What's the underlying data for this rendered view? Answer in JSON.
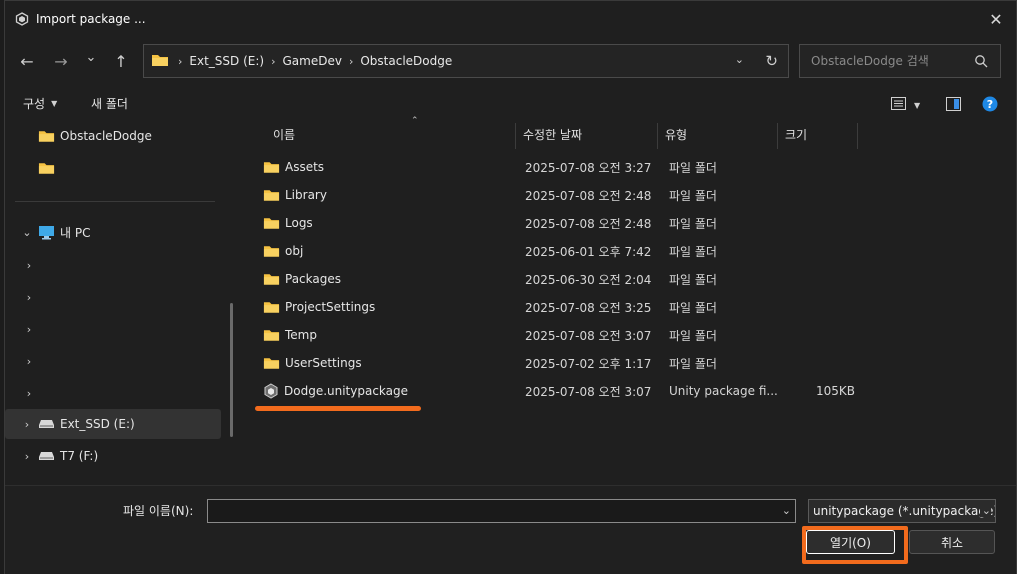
{
  "window": {
    "title": "Import package ...",
    "close_glyph": "✕"
  },
  "nav": {
    "back_glyph": "←",
    "forward_glyph": "→",
    "recent_glyph": "⌄",
    "up_glyph": "↑",
    "breadcrumb": [
      "Ext_SSD (E:)",
      "GameDev",
      "ObstacleDodge"
    ],
    "breadcrumb_sep": "›",
    "search_placeholder": "ObstacleDodge 검색"
  },
  "commandbar": {
    "organize": "구성",
    "new_folder": "새 폴더"
  },
  "sidebar": {
    "items": [
      {
        "label": "ObstacleDodge",
        "icon": "folder-icon"
      },
      {
        "label": "",
        "icon": "folder-icon"
      },
      {
        "label": "내 PC",
        "icon": "pc-icon"
      },
      {
        "label": ""
      },
      {
        "label": ""
      },
      {
        "label": ""
      },
      {
        "label": ""
      },
      {
        "label": ""
      },
      {
        "label": "Ext_SSD (E:)",
        "icon": "drive-icon"
      },
      {
        "label": "T7 (F:)",
        "icon": "drive-icon"
      }
    ]
  },
  "columns": {
    "name": "이름",
    "date": "수정한 날짜",
    "type": "유형",
    "size": "크기"
  },
  "files": [
    {
      "name": "Assets",
      "date": "2025-07-08 오전 3:27",
      "type": "파일 폴더",
      "size": "",
      "icon": "folder-icon"
    },
    {
      "name": "Library",
      "date": "2025-07-08 오전 2:48",
      "type": "파일 폴더",
      "size": "",
      "icon": "folder-icon"
    },
    {
      "name": "Logs",
      "date": "2025-07-08 오전 2:48",
      "type": "파일 폴더",
      "size": "",
      "icon": "folder-icon"
    },
    {
      "name": "obj",
      "date": "2025-06-01 오후 7:42",
      "type": "파일 폴더",
      "size": "",
      "icon": "folder-icon"
    },
    {
      "name": "Packages",
      "date": "2025-06-30 오전 2:04",
      "type": "파일 폴더",
      "size": "",
      "icon": "folder-icon"
    },
    {
      "name": "ProjectSettings",
      "date": "2025-07-08 오전 3:25",
      "type": "파일 폴더",
      "size": "",
      "icon": "folder-icon"
    },
    {
      "name": "Temp",
      "date": "2025-07-08 오전 3:07",
      "type": "파일 폴더",
      "size": "",
      "icon": "folder-icon"
    },
    {
      "name": "UserSettings",
      "date": "2025-07-02 오후 1:17",
      "type": "파일 폴더",
      "size": "",
      "icon": "folder-icon"
    },
    {
      "name": "Dodge.unitypackage",
      "date": "2025-07-08 오전 3:07",
      "type": "Unity package fi...",
      "size": "105KB",
      "icon": "unity-package-icon"
    }
  ],
  "bottom": {
    "filename_label": "파일 이름(N):",
    "filename_value": "",
    "filter": "unitypackage (*.unitypackage)",
    "open_button": "열기(O)",
    "cancel_button": "취소"
  },
  "colors": {
    "accent_annotation": "#f26b1d",
    "folder": "#f5c242",
    "help": "#1e88e5"
  }
}
